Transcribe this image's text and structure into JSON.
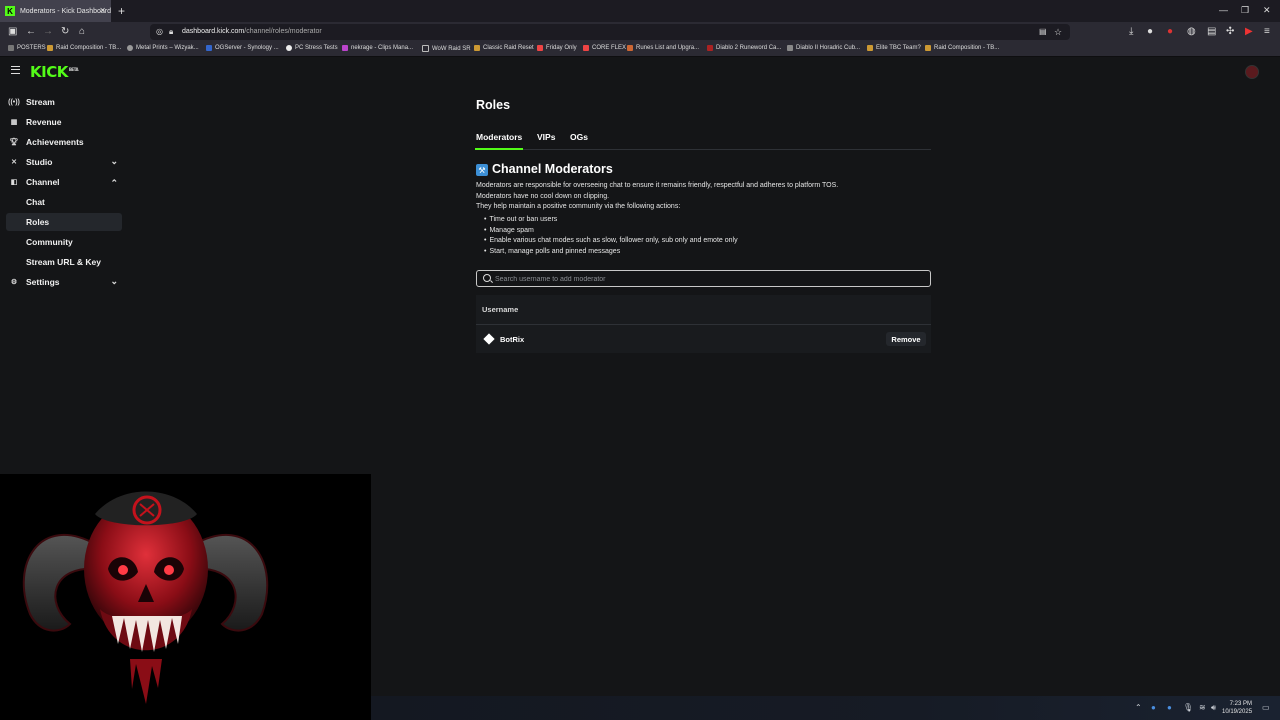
{
  "browser": {
    "tab_title": "Moderators - Kick Dashboard",
    "tab_favicon": "K",
    "url_domain": "dashboard.kick.com",
    "url_path": "/channel/roles/moderator",
    "bookmarks": [
      "POSTERS",
      "Raid Composition - TB...",
      "Metal Prints – Wizyak...",
      "OGServer - Synology ...",
      "PC Stress Tests",
      "nekrage - Clips Mana...",
      "WoW Raid SR",
      "Classic Raid Reset",
      "Friday Only",
      "CORE FLEX",
      "Runes List and Upgra...",
      "Diablo 2 Runeword Ca...",
      "Diablo II Horadric Cub...",
      "Elite TBC Team?",
      "Raid Composition - TB..."
    ]
  },
  "kick": {
    "logo": "KICK",
    "logo_badge": "BETA"
  },
  "sidebar": {
    "stream": "Stream",
    "revenue": "Revenue",
    "achievements": "Achievements",
    "studio": "Studio",
    "channel": "Channel",
    "chat": "Chat",
    "roles": "Roles",
    "community": "Community",
    "stream_url_key": "Stream URL & Key",
    "settings": "Settings"
  },
  "main": {
    "title": "Roles",
    "tabs": {
      "moderators": "Moderators",
      "vips": "VIPs",
      "ogs": "OGs"
    },
    "section_title": "Channel Moderators",
    "desc_1": "Moderators are responsible for overseeing chat to ensure it remains friendly, respectful and adheres to platform TOS.",
    "desc_2": "Moderators have no cool down on clipping.",
    "desc_3": "They help maintain a positive community via the following actions:",
    "actions": [
      "Time out or ban users",
      "Manage spam",
      "Enable various chat modes such as slow, follower only, sub only and emote only",
      "Start, manage polls and pinned messages"
    ],
    "search_placeholder": "Search username to add moderator",
    "table_header": "Username",
    "moderators": [
      {
        "username": "BotRix",
        "action": "Remove"
      }
    ]
  },
  "taskbar": {
    "time": "7:23 PM",
    "date": "10/19/2025"
  },
  "colors": {
    "accent": "#53fc18",
    "background": "#141517",
    "panel": "#191b1e"
  }
}
